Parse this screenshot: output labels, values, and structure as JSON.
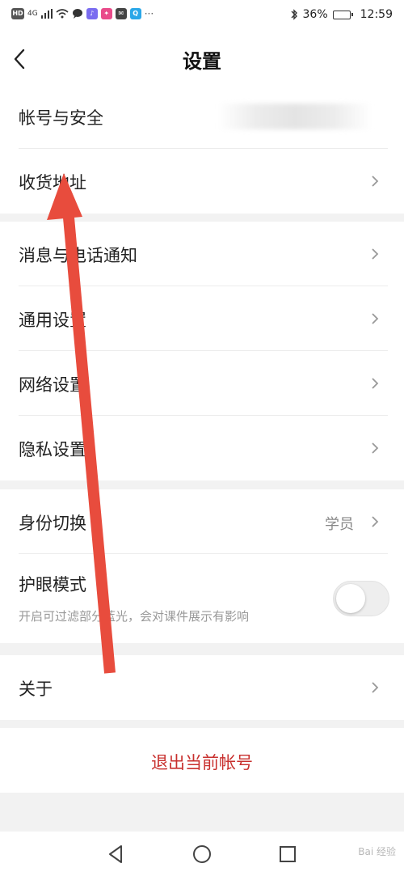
{
  "status_bar": {
    "left_badges": [
      "HD",
      "4G"
    ],
    "battery": "36%",
    "battery_level": 0.36,
    "time": "12:59"
  },
  "header": {
    "title": "设置"
  },
  "groups": [
    {
      "rows": [
        {
          "label": "帐号与安全",
          "value": "",
          "blurred_value": true
        },
        {
          "label": "收货地址"
        }
      ]
    },
    {
      "rows": [
        {
          "label": "消息与电话通知"
        },
        {
          "label": "通用设置"
        },
        {
          "label": "网络设置"
        },
        {
          "label": "隐私设置"
        }
      ]
    },
    {
      "rows": [
        {
          "label": "身份切换",
          "value": "学员"
        },
        {
          "label": "护眼模式",
          "description": "开启可过滤部分蓝光，会对课件展示有影响",
          "toggle_on": false
        }
      ]
    },
    {
      "rows": [
        {
          "label": "关于"
        }
      ]
    }
  ],
  "logout": {
    "label": "退出当前帐号"
  },
  "colors": {
    "accent_red": "#c8302e",
    "annotation_arrow": "#e84c3d"
  },
  "watermark": "Bai 经验"
}
